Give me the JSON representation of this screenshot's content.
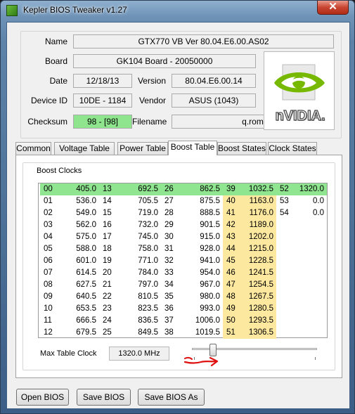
{
  "window": {
    "title": "Kepler BIOS Tweaker v1.27",
    "close_glyph": "✕"
  },
  "info": {
    "name_label": "Name",
    "name_value": "GTX770 VB Ver 80.04.E6.00.AS02",
    "board_label": "Board",
    "board_value": "GK104 Board - 20050000",
    "date_label": "Date",
    "date_value": "12/18/13",
    "version_label": "Version",
    "version_value": "80.04.E6.00.14",
    "device_id_label": "Device ID",
    "device_id_value": "10DE - 1184",
    "vendor_label": "Vendor",
    "vendor_value": "ASUS (1043)",
    "checksum_label": "Checksum",
    "checksum_value": "98 - [98]",
    "filename_label": "Filename",
    "filename_value": "q.rom",
    "checksum_color": "#8ee58e"
  },
  "logo": {
    "wordmark": "nVIDIA.",
    "icon": "nvidia-eye-logo",
    "color": "#76b900"
  },
  "tabs": [
    {
      "label": "Common"
    },
    {
      "label": "Voltage Table"
    },
    {
      "label": "Power Table"
    },
    {
      "label": "Boost Table",
      "active": true
    },
    {
      "label": "Boost States"
    },
    {
      "label": "Clock States"
    }
  ],
  "boost": {
    "group_label": "Boost Clocks",
    "columns": [
      {
        "idx": [
          "00",
          "01",
          "02",
          "03",
          "04",
          "05",
          "06",
          "07",
          "08",
          "09",
          "10",
          "11",
          "12"
        ],
        "val": [
          "405.0",
          "536.0",
          "549.0",
          "562.0",
          "575.0",
          "588.0",
          "601.0",
          "614.5",
          "627.5",
          "640.5",
          "653.5",
          "666.5",
          "679.5"
        ]
      },
      {
        "idx": [
          "13",
          "14",
          "15",
          "16",
          "17",
          "18",
          "19",
          "20",
          "21",
          "22",
          "23",
          "24",
          "25"
        ],
        "val": [
          "692.5",
          "705.5",
          "719.0",
          "732.0",
          "745.0",
          "758.0",
          "771.0",
          "784.0",
          "797.0",
          "810.5",
          "823.5",
          "836.5",
          "849.5"
        ]
      },
      {
        "idx": [
          "26",
          "27",
          "28",
          "29",
          "30",
          "31",
          "32",
          "33",
          "34",
          "35",
          "36",
          "37",
          "38"
        ],
        "val": [
          "862.5",
          "875.5",
          "888.5",
          "901.5",
          "915.0",
          "928.0",
          "941.0",
          "954.0",
          "967.0",
          "980.0",
          "993.0",
          "1006.0",
          "1019.5"
        ]
      },
      {
        "idx": [
          "39",
          "40",
          "41",
          "42",
          "43",
          "44",
          "45",
          "46",
          "47",
          "48",
          "49",
          "50",
          "51"
        ],
        "val": [
          "1032.5",
          "1163.0",
          "1176.0",
          "1189.0",
          "1202.0",
          "1215.0",
          "1228.5",
          "1241.5",
          "1254.5",
          "1267.5",
          "1280.5",
          "1293.5",
          "1306.5"
        ]
      },
      {
        "idx": [
          "52",
          "53",
          "54"
        ],
        "val": [
          "1320.0",
          "0.0",
          "0.0"
        ]
      }
    ],
    "highlight_green": "#90e690",
    "highlight_yellow": "#fde8a0",
    "max_clock_label": "Max Table Clock",
    "max_clock_value": "1320.0 MHz",
    "slider_level": 0.17
  },
  "buttons": {
    "open": "Open BIOS",
    "save": "Save BIOS",
    "save_as": "Save BIOS As"
  }
}
